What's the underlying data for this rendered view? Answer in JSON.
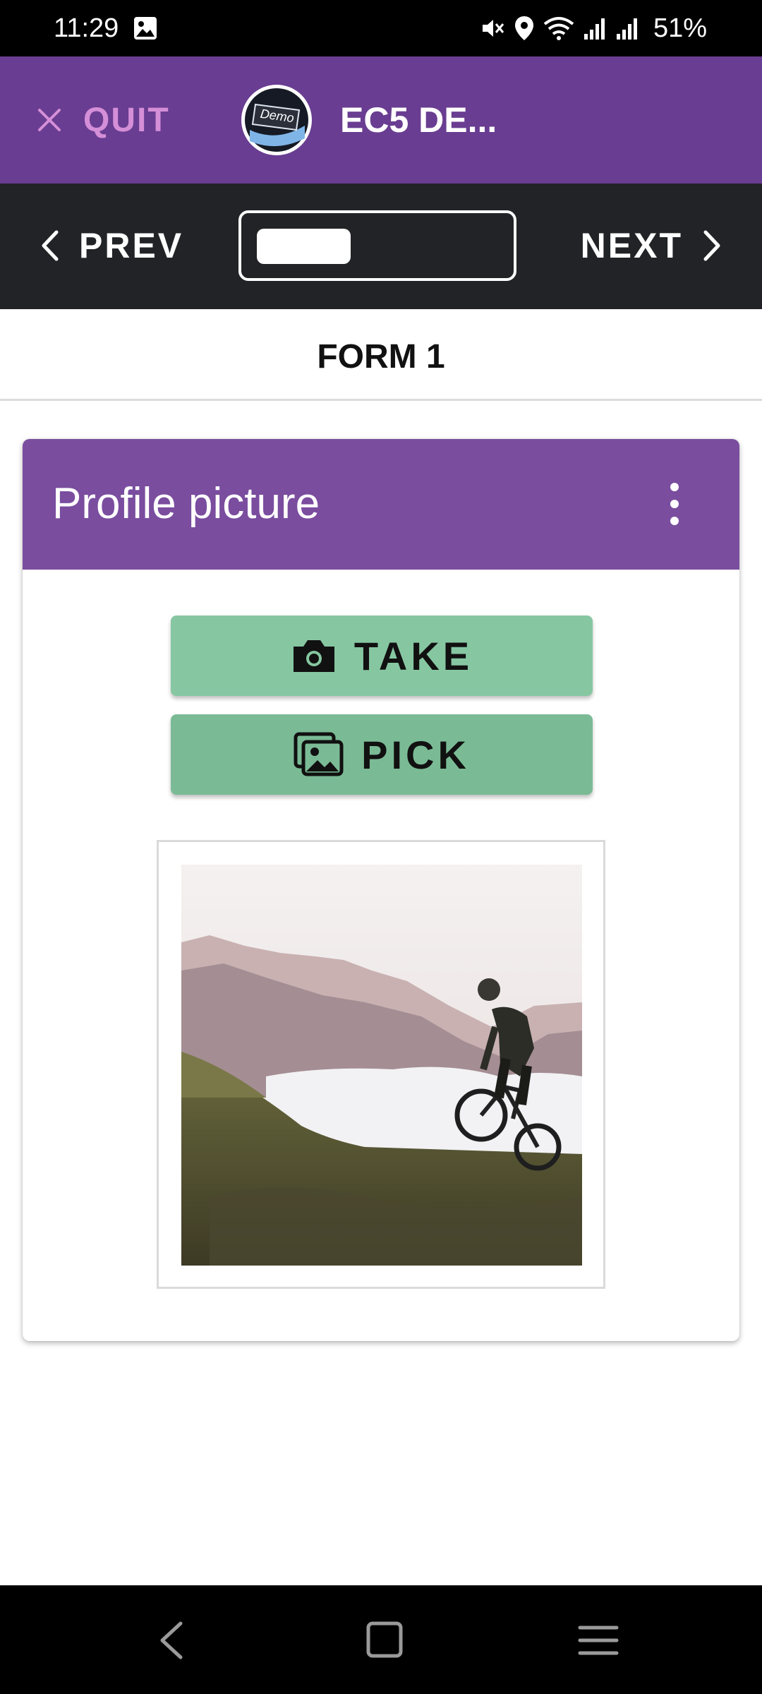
{
  "status_bar": {
    "time": "11:29",
    "battery": "51%"
  },
  "app_bar": {
    "quit_label": "QUIT",
    "logo_text": "Demo",
    "title": "EC5 DE..."
  },
  "nav": {
    "prev_label": "PREV",
    "next_label": "NEXT",
    "progress_fraction": 0.38
  },
  "form": {
    "title": "FORM 1"
  },
  "question": {
    "label": "Profile picture",
    "take_label": "TAKE",
    "pick_label": "PICK"
  },
  "colors": {
    "app_bar": "#693d91",
    "quit_accent": "#d58fd8",
    "card_header": "#7a4d9f",
    "take_button": "#86c7a2",
    "pick_button": "#7abb95",
    "nav_bar": "#222326"
  },
  "icons": {
    "quit": "close-icon",
    "prev": "chevron-left-icon",
    "next": "chevron-right-icon",
    "more": "more-vertical-icon",
    "take": "camera-icon",
    "pick": "gallery-icon"
  }
}
